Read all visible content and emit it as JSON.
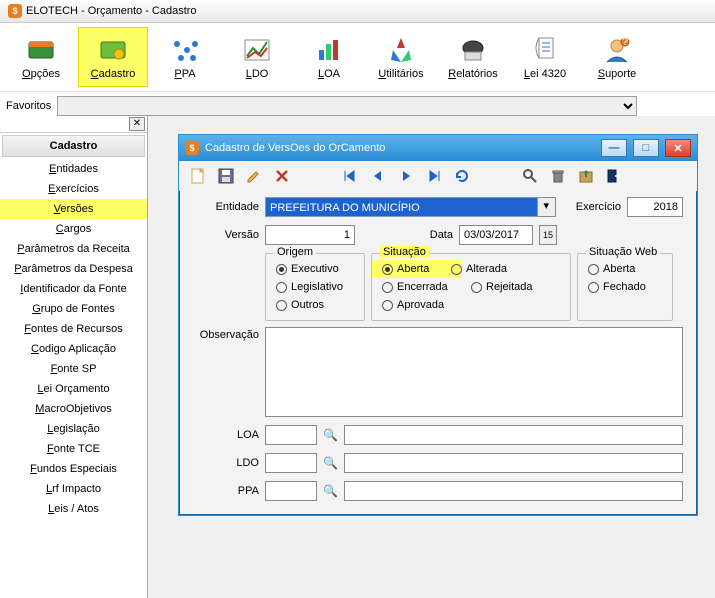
{
  "window": {
    "title": "ELOTECH - Orçamento -   Cadastro"
  },
  "toolbar": {
    "items": [
      {
        "label": "Opções",
        "u": "O"
      },
      {
        "label": "Cadastro",
        "u": "C",
        "active": true
      },
      {
        "label": "PPA",
        "u": "P"
      },
      {
        "label": "LDO",
        "u": "L"
      },
      {
        "label": "LOA",
        "u": "L"
      },
      {
        "label": "Utilitários",
        "u": "U"
      },
      {
        "label": "Relatórios",
        "u": "R"
      },
      {
        "label": "Lei 4320",
        "u": "L"
      },
      {
        "label": "Suporte",
        "u": "S"
      }
    ]
  },
  "favorites": {
    "label": "Favoritos"
  },
  "sidebar": {
    "header": "Cadastro",
    "items": [
      {
        "label": "Entidades",
        "u": "E"
      },
      {
        "label": "Exercícios",
        "u": "E"
      },
      {
        "label": "Versões",
        "u": "V",
        "highlight": true
      },
      {
        "label": "Cargos",
        "u": "C"
      },
      {
        "label": "Parâmetros da Receita",
        "u": "P"
      },
      {
        "label": "Parâmetros da Despesa",
        "u": "P"
      },
      {
        "label": "Identificador da Fonte",
        "u": "I"
      },
      {
        "label": "Grupo de Fontes",
        "u": "G"
      },
      {
        "label": "Fontes de Recursos",
        "u": "F"
      },
      {
        "label": "Codigo Aplicação",
        "u": "C"
      },
      {
        "label": "Fonte SP",
        "u": "F"
      },
      {
        "label": "Lei Orçamento",
        "u": "L"
      },
      {
        "label": "MacroObjetivos",
        "u": "M"
      },
      {
        "label": "Legislação",
        "u": "L"
      },
      {
        "label": "Fonte TCE",
        "u": "F"
      },
      {
        "label": "Fundos Especiais",
        "u": "F"
      },
      {
        "label": "Lrf Impacto",
        "u": "L"
      },
      {
        "label": "Leis / Atos",
        "u": "L"
      }
    ]
  },
  "mdi": {
    "title": "Cadastro de VersOes do OrCamento",
    "form": {
      "entidade_label": "Entidade",
      "entidade_value": "PREFEITURA DO MUNICÍPIO",
      "exercicio_label": "Exercício",
      "exercicio_value": "2018",
      "versao_label": "Versão",
      "versao_value": "1",
      "data_label": "Data",
      "data_value": "03/03/2017",
      "origem": {
        "label": "Origem",
        "options": [
          "Executivo",
          "Legislativo",
          "Outros"
        ],
        "selected": "Executivo"
      },
      "situacao": {
        "label": "Situação",
        "options": [
          "Aberta",
          "Encerrada",
          "Aprovada",
          "Alterada",
          "Rejeitada"
        ],
        "selected": "Aberta"
      },
      "situacao_web": {
        "label": "Situação Web",
        "options": [
          "Aberta",
          "Fechado"
        ],
        "selected": ""
      },
      "observacao_label": "Observação",
      "loa_label": "LOA",
      "ldo_label": "LDO",
      "ppa_label": "PPA"
    }
  }
}
